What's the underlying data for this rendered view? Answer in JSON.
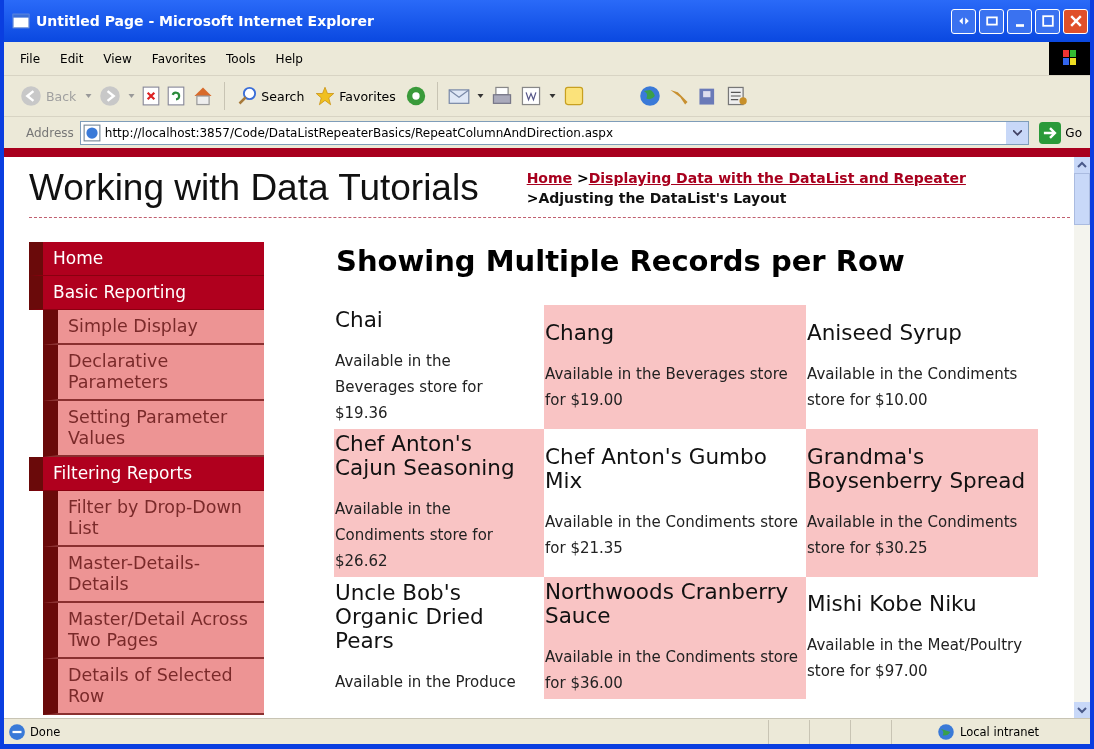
{
  "window": {
    "title": "Untitled Page - Microsoft Internet Explorer"
  },
  "menu": [
    "File",
    "Edit",
    "View",
    "Favorites",
    "Tools",
    "Help"
  ],
  "toolbar": [
    {
      "label": "Back",
      "disabled": true
    },
    {
      "label": "Search",
      "disabled": false
    },
    {
      "label": "Favorites",
      "disabled": false
    }
  ],
  "address": {
    "label": "Address",
    "value": "http://localhost:3857/Code/DataListRepeaterBasics/RepeatColumnAndDirection.aspx",
    "go": "Go"
  },
  "site_title": "Working with Data Tutorials",
  "breadcrumb": {
    "links": [
      "Home",
      "Displaying Data with the DataList and Repeater"
    ],
    "separator": ">",
    "current": "Adjusting the DataList's Layout"
  },
  "sidebar": {
    "items": [
      {
        "label": "Home"
      },
      {
        "label": "Basic Reporting",
        "children": [
          {
            "label": "Simple Display"
          },
          {
            "label": "Declarative Parameters"
          },
          {
            "label": "Setting Parameter Values"
          }
        ]
      },
      {
        "label": "Filtering Reports",
        "children": [
          {
            "label": "Filter by Drop-Down List"
          },
          {
            "label": "Master-Details-Details"
          },
          {
            "label": "Master/Detail Across Two Pages"
          },
          {
            "label": "Details of Selected Row"
          }
        ]
      }
    ]
  },
  "heading": "Showing Multiple Records per Row",
  "products": [
    {
      "name": "Chai",
      "description": "Available in the Beverages store for $19.36",
      "highlighted": false
    },
    {
      "name": "Chang",
      "description": "Available in the Beverages store for $19.00",
      "highlighted": true
    },
    {
      "name": "Aniseed Syrup",
      "description": "Available in the Condiments store for $10.00",
      "highlighted": false
    },
    {
      "name": "Chef Anton's Cajun Seasoning",
      "description": "Available in the Condiments store for $26.62",
      "highlighted": true
    },
    {
      "name": "Chef Anton's Gumbo Mix",
      "description": "Available in the Condiments store for $21.35",
      "highlighted": false
    },
    {
      "name": "Grandma's Boysenberry Spread",
      "description": "Available in the Condiments store for $30.25",
      "highlighted": true
    },
    {
      "name": "Uncle Bob's Organic Dried Pears",
      "description": "Available in the Produce",
      "highlighted": false
    },
    {
      "name": "Northwoods Cranberry Sauce",
      "description": "Available in the Condiments store for $36.00",
      "highlighted": true
    },
    {
      "name": "Mishi Kobe Niku",
      "description": "Available in the Meat/Poultry store for $97.00",
      "highlighted": false
    }
  ],
  "status_bar": {
    "status": "Done",
    "zone": "Local intranet"
  }
}
